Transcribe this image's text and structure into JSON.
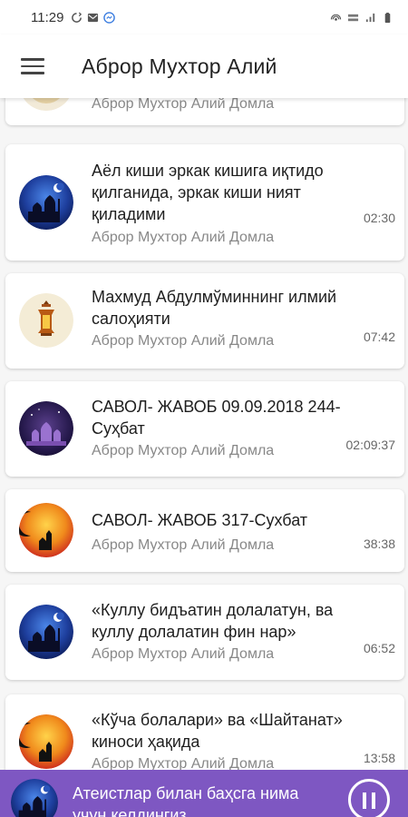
{
  "status_bar": {
    "time": "11:29",
    "left_icons": [
      "sync-icon",
      "mail-icon",
      "messenger-icon"
    ],
    "right_icons": [
      "hotspot-icon",
      "volte-icon",
      "signal-icon",
      "battery-icon"
    ]
  },
  "app_bar": {
    "title": "Аброр Мухтор Алий",
    "menu_icon": "hamburger-menu-icon"
  },
  "items": [
    {
      "title": "",
      "author": "Аброр Мухтор Алий Домла",
      "duration": "",
      "icon": "scroll-partial-icon"
    },
    {
      "title": "Аёл киши эркак кишига иқтидо қилганида, эркак киши ният қиладими",
      "author": "Аброр Мухтор Алий Домла",
      "duration": "02:30",
      "icon": "mosque-night-icon"
    },
    {
      "title": "Махмуд Абдулмўминнинг илмий салоҳияти",
      "author": "Аброр Мухтор Алий Домла",
      "duration": "07:42",
      "icon": "lantern-icon"
    },
    {
      "title": "САВОЛ- ЖАВОБ 09.09.2018 244-Суҳбат",
      "author": "Аброр Мухтор Алий Домла",
      "duration": "02:09:37",
      "icon": "mosque-purple-icon"
    },
    {
      "title": "САВОЛ- ЖАВОБ 317-Сухбат",
      "author": "Аброр Мухтор Алий Домла",
      "duration": "38:38",
      "icon": "crescent-sunset-icon"
    },
    {
      "title": "«Куллу бидъатин долалатун, ва куллу долалатин фин нар»",
      "author": "Аброр Мухтор Алий Домла",
      "duration": "06:52",
      "icon": "mosque-night-icon"
    },
    {
      "title": "«Кўча болалари» ва «Шайтанат» киноси ҳақида",
      "author": "Аброр Мухтор Алий Домла",
      "duration": "13:58",
      "icon": "crescent-sunset-icon"
    }
  ],
  "player": {
    "title": "Атеистлар билан баҳсга нима учун келдингиз",
    "icon": "mosque-night-icon",
    "control_icon": "pause-icon"
  },
  "colors": {
    "player_bg": "#7e57c2",
    "card_bg": "#ffffff",
    "author_text": "#888888"
  }
}
